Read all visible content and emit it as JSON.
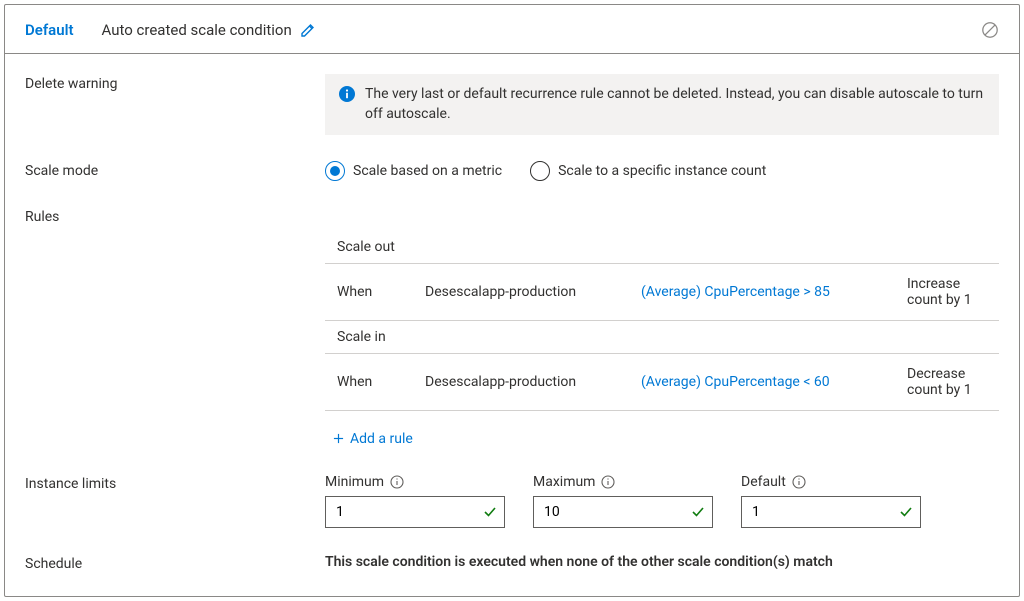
{
  "header": {
    "profile_name": "Default",
    "condition_name": "Auto created scale condition"
  },
  "delete_warning": {
    "label": "Delete warning",
    "message": "The very last or default recurrence rule cannot be deleted. Instead, you can disable autoscale to turn off autoscale."
  },
  "scale_mode": {
    "label": "Scale mode",
    "options": {
      "metric": "Scale based on a metric",
      "fixed": "Scale to a specific instance count"
    }
  },
  "rules": {
    "label": "Rules",
    "scale_out_header": "Scale out",
    "scale_in_header": "Scale in",
    "out": {
      "when": "When",
      "resource": "Desescalapp-production",
      "criteria": "(Average) CpuPercentage > 85",
      "action": "Increase count by 1"
    },
    "in": {
      "when": "When",
      "resource": "Desescalapp-production",
      "criteria": "(Average) CpuPercentage < 60",
      "action": "Decrease count by 1"
    },
    "add_rule": "Add a rule"
  },
  "instance_limits": {
    "label": "Instance limits",
    "minimum": {
      "label": "Minimum",
      "value": "1"
    },
    "maximum": {
      "label": "Maximum",
      "value": "10"
    },
    "default": {
      "label": "Default",
      "value": "1"
    }
  },
  "schedule": {
    "label": "Schedule",
    "text": "This scale condition is executed when none of the other scale condition(s) match"
  }
}
